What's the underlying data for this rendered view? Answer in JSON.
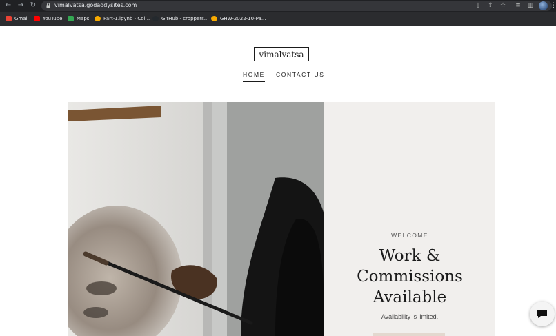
{
  "browser": {
    "url": "vimalvatsa.godaddysites.com",
    "bookmarks": [
      {
        "label": "Gmail",
        "icon": "gmail-icon",
        "color": "#ea4335"
      },
      {
        "label": "YouTube",
        "icon": "youtube-icon",
        "color": "#ff0000"
      },
      {
        "label": "Maps",
        "icon": "maps-icon",
        "color": "#34a853"
      },
      {
        "label": "Part-1.ipynb - Col...",
        "icon": "colab-icon",
        "color": "#f9ab00"
      },
      {
        "label": "GitHub - croppers...",
        "icon": "github-icon",
        "color": "#24292e"
      },
      {
        "label": "GHW-2022-10-Pa...",
        "icon": "colab-icon",
        "color": "#f9ab00"
      }
    ]
  },
  "site": {
    "logo": "vimalvatsa",
    "nav": {
      "home": "HOME",
      "contact": "CONTACT US"
    },
    "hero": {
      "eyebrow": "WELCOME",
      "title_lines": [
        "Work &",
        "Commissions",
        "Available"
      ],
      "subtitle": "Availability is limited."
    }
  },
  "colors": {
    "panel": "#f1efed",
    "accent": "#e3d8cf"
  }
}
